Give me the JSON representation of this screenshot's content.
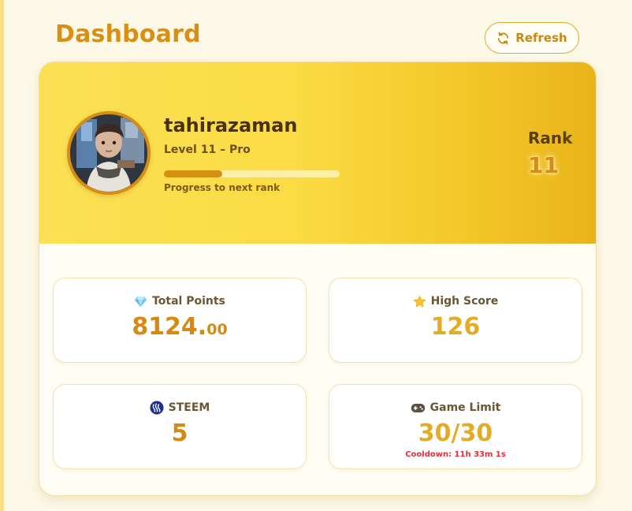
{
  "header": {
    "title": "Dashboard",
    "refresh_label": "Refresh"
  },
  "profile": {
    "username": "tahirazaman",
    "level": "Level 11 – Pro",
    "progress_fraction": 0.33,
    "progress_label": "Progress to next rank",
    "rank_label": "Rank",
    "rank_value": "11"
  },
  "stats": {
    "total_points": {
      "label": "Total Points",
      "value_integer": "8124.",
      "value_decimals": "00",
      "icon": "gem-icon"
    },
    "high_score": {
      "label": "High Score",
      "value": "126",
      "icon": "star-icon"
    },
    "steem": {
      "label": "STEEM",
      "value": "5",
      "icon": "steem-logo-icon"
    },
    "game_limit": {
      "label": "Game Limit",
      "value": "30/30",
      "cooldown": "Cooldown: 11h 33m 1s",
      "icon": "gamepad-icon"
    }
  },
  "colors": {
    "accent": "#d58d16",
    "header_gradient_start": "#fbe055",
    "header_gradient_end": "#e8b41a",
    "cooldown": "#e0313c"
  }
}
